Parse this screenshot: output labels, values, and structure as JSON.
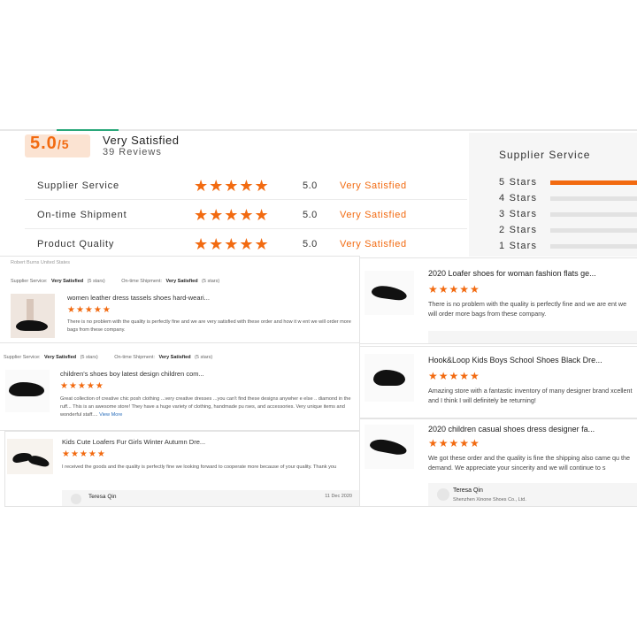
{
  "summary": {
    "score": "5.0",
    "score_suffix": "/5",
    "title": "Very Satisfied",
    "reviews": "39 Reviews",
    "rows": [
      {
        "label": "Supplier Service",
        "stars": "★★★★★",
        "value": "5.0",
        "word": "Very Satisfied"
      },
      {
        "label": "On-time Shipment",
        "stars": "★★★★★",
        "value": "5.0",
        "word": "Very Satisfied"
      },
      {
        "label": "Product Quality",
        "stars": "★★★★★",
        "value": "5.0",
        "word": "Very Satisfied"
      }
    ]
  },
  "supplier_panel": {
    "title": "Supplier Service",
    "bars": [
      {
        "label": "5 Stars",
        "fraction": 1.0
      },
      {
        "label": "4 Stars",
        "fraction": 0
      },
      {
        "label": "3 Stars",
        "fraction": 0
      },
      {
        "label": "2 Stars",
        "fraction": 0
      },
      {
        "label": "1 Stars",
        "fraction": 0
      }
    ]
  },
  "review1": {
    "reviewer": "Robert Burns United States",
    "ss_label": "Supplier Service:",
    "ss_value": "Very Satisfied",
    "ss_stars": "(5 stars)",
    "os_label": "On-time Shipment:",
    "os_value": "Very Satisfied",
    "os_stars": "(5 stars)",
    "product": "women leather dress tassels shoes hard-weari...",
    "stars": "★★★★★",
    "text": "There is no problem with the quality is perfectly fine and we are very satisfied with these order and how it w ent we will order more bags from these company."
  },
  "review2": {
    "ss_label": "Supplier Service:",
    "ss_value": "Very Satisfied",
    "ss_stars": "(5 stars)",
    "os_label": "On-time Shipment:",
    "os_value": "Very Satisfied",
    "os_stars": "(5 stars)",
    "product": "children's shoes boy latest design children com...",
    "stars": "★★★★★",
    "text": "Great collection of creative chic posh clothing ...very creative dresses ...you can't find these designs anywher e else .. diamond in the ruff... This is an awesome store! They have a huge variety of clothing, handmade pu rses, and accessories. Very unique items and wonderful staff....",
    "more": "View More"
  },
  "review3": {
    "product": "Kids Cute Loafers Fur Girls Winter Autumn Dre...",
    "stars": "★★★★★",
    "text": "I received the goods and the quality is perfectly fine we looking forward to cooperate more because of your quality. Thank you",
    "reply_name": "Teresa Qin",
    "reply_date": "11 Dec 2020"
  },
  "right1": {
    "product": "2020 Loafer shoes for woman fashion flats ge...",
    "stars": "★★★★★",
    "text": "There is no problem with the quality is perfectly fine and we are ent we will order more bags from these company."
  },
  "right2": {
    "product": "Hook&Loop Kids Boys School Shoes Black Dre...",
    "stars": "★★★★★",
    "text": "Amazing store with a fantastic inventory of many designer brand xcellent and I think I will definitely be returning!"
  },
  "right3": {
    "product": "2020 children casual shoes dress designer fa...",
    "stars": "★★★★★",
    "text": "We got these order and the quality is fine the shipping also came qu the demand. We appreciate your sincerity and we will continue to s",
    "reply_name": "Teresa Qin",
    "reply_company": "Shenzhen Xinone Shoes Co., Ltd."
  },
  "colors": {
    "accent": "#f26a10"
  }
}
